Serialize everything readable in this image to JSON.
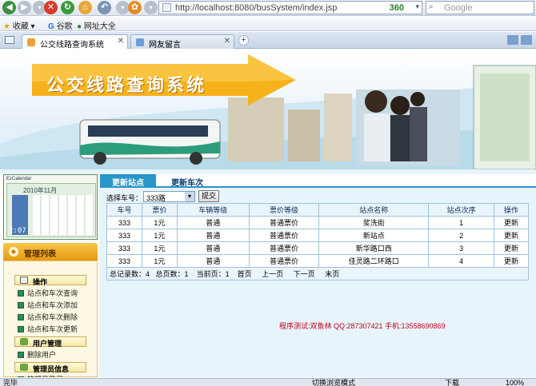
{
  "browser": {
    "url": "http://localhost:8080/busSystem/index.jsp",
    "badge_360": "360",
    "search_placeholder": "Google",
    "favorites": [
      "收藏",
      "谷歌",
      "网址大全"
    ],
    "tabs": [
      {
        "label": "公交线路查询系统",
        "active": true
      },
      {
        "label": "网友留言",
        "active": false
      }
    ],
    "status_left": "完毕",
    "status_items": [
      "切换浏览模式",
      "下载",
      "100%"
    ]
  },
  "banner": {
    "title": "公交线路查询系统"
  },
  "nav": {
    "tabs": [
      "更新站点",
      "更新车次"
    ]
  },
  "sidebar": {
    "calendar_title": "EzCalendar",
    "calendar_caption": "2010年11月",
    "calendar_time": "2:07",
    "panel_title": "管理列表",
    "sections": [
      {
        "title": "操作",
        "items": [
          "站点和车次查询",
          "站点和车次添加",
          "站点和车次删除",
          "站点和车次更新"
        ]
      },
      {
        "title": "用户管理",
        "items": [
          "删除用户"
        ]
      },
      {
        "title": "管理员信息",
        "items": [
          "管理员登录"
        ]
      }
    ]
  },
  "content": {
    "select_label": "选择车号：",
    "select_value": "333路",
    "submit_label": "提交",
    "columns": [
      "车号",
      "票价",
      "车辆等级",
      "票价等级",
      "站点名称",
      "站点次序",
      "操作"
    ],
    "rows": [
      [
        "333",
        "1元",
        "普通",
        "普通票价",
        "浆洗街",
        "1",
        "更新"
      ],
      [
        "333",
        "1元",
        "普通",
        "普通票价",
        "新站点",
        "2",
        "更新"
      ],
      [
        "333",
        "1元",
        "普通",
        "普通票价",
        "新华路口西",
        "3",
        "更新"
      ],
      [
        "333",
        "1元",
        "普通",
        "普通票价",
        "佳灵路二环路口",
        "4",
        "更新"
      ]
    ],
    "pagination": {
      "total_records": "总记录数：4",
      "total_pages": "总页数：1",
      "current_page": "当前页：1",
      "first": "首页",
      "prev": "上一页",
      "next": "下一页",
      "last": "末页"
    },
    "footer_note": "程序测试:双鱼林 QQ:287307421 手机:13558690869"
  }
}
